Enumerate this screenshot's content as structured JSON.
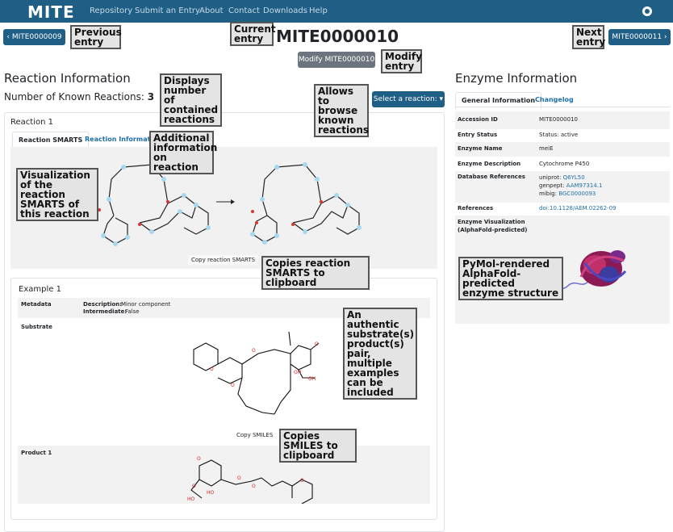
{
  "nav": {
    "logo": "MITE",
    "links": [
      "Repository",
      "Submit an Entry",
      "About",
      "Contact",
      "Downloads",
      "Help"
    ]
  },
  "header": {
    "prev_label": "MITE0000009",
    "next_label": "MITE0000011",
    "title": "MITE0000010",
    "modify_label": "Modify MITE0000010"
  },
  "callouts": {
    "previous": "Previous entry",
    "current": "Current entry",
    "next": "Next entry",
    "modify": "Modify entry",
    "displays": "Displays number of contained reactions",
    "browse": "Allows to browse known reactions",
    "additional": "Additional information on reaction",
    "visualization": "Visualization of the reaction SMARTS of this reaction",
    "copies_smarts": "Copies reaction SMARTS to clipboard",
    "authentic": "An authentic substrate(s) product(s) pair, multiple examples can be included",
    "copies_smiles": "Copies SMILES to clipboard",
    "pymol": "PyMol-rendered AlphaFold-predicted enzyme structure"
  },
  "reaction": {
    "heading": "Reaction Information",
    "known_label": "Number of Known Reactions:",
    "known_count": "3",
    "select_label": "Select a reaction:",
    "panel_title": "Reaction 1",
    "tab_smarts": "Reaction SMARTS",
    "tab_info": "Reaction Information",
    "copy_smarts": "Copy reaction SMARTS",
    "example_title": "Example 1",
    "metadata_label": "Metadata",
    "description_key": "Description:",
    "description_val": "Minor component",
    "intermediate_key": "Intermediate:",
    "intermediate_val": "False",
    "substrate_label": "Substrate",
    "copy_smiles": "Copy SMILES",
    "product_label": "Product 1"
  },
  "enzyme": {
    "heading": "Enzyme Information",
    "tab_general": "General Information",
    "tab_changelog": "Changelog",
    "rows": {
      "accession_key": "Accession ID",
      "accession_val": "MITE0000010",
      "status_key": "Entry Status",
      "status_val": "Status: active",
      "name_key": "Enzyme Name",
      "name_val": "meiE",
      "desc_key": "Enzyme Description",
      "desc_val": "Cytochrome P450",
      "db_key": "Database References",
      "uniprot_key": "uniprot:",
      "uniprot_val": "Q6YL50",
      "genpept_key": "genpept:",
      "genpept_val": "AAM97314.1",
      "mibig_key": "mibig:",
      "mibig_val": "BGC0000093",
      "ref_key": "References",
      "ref_val": "doi:10.1128/AEM.02262-09",
      "viz_key": "Enzyme Visualization (AlphaFold-predicted)"
    }
  }
}
